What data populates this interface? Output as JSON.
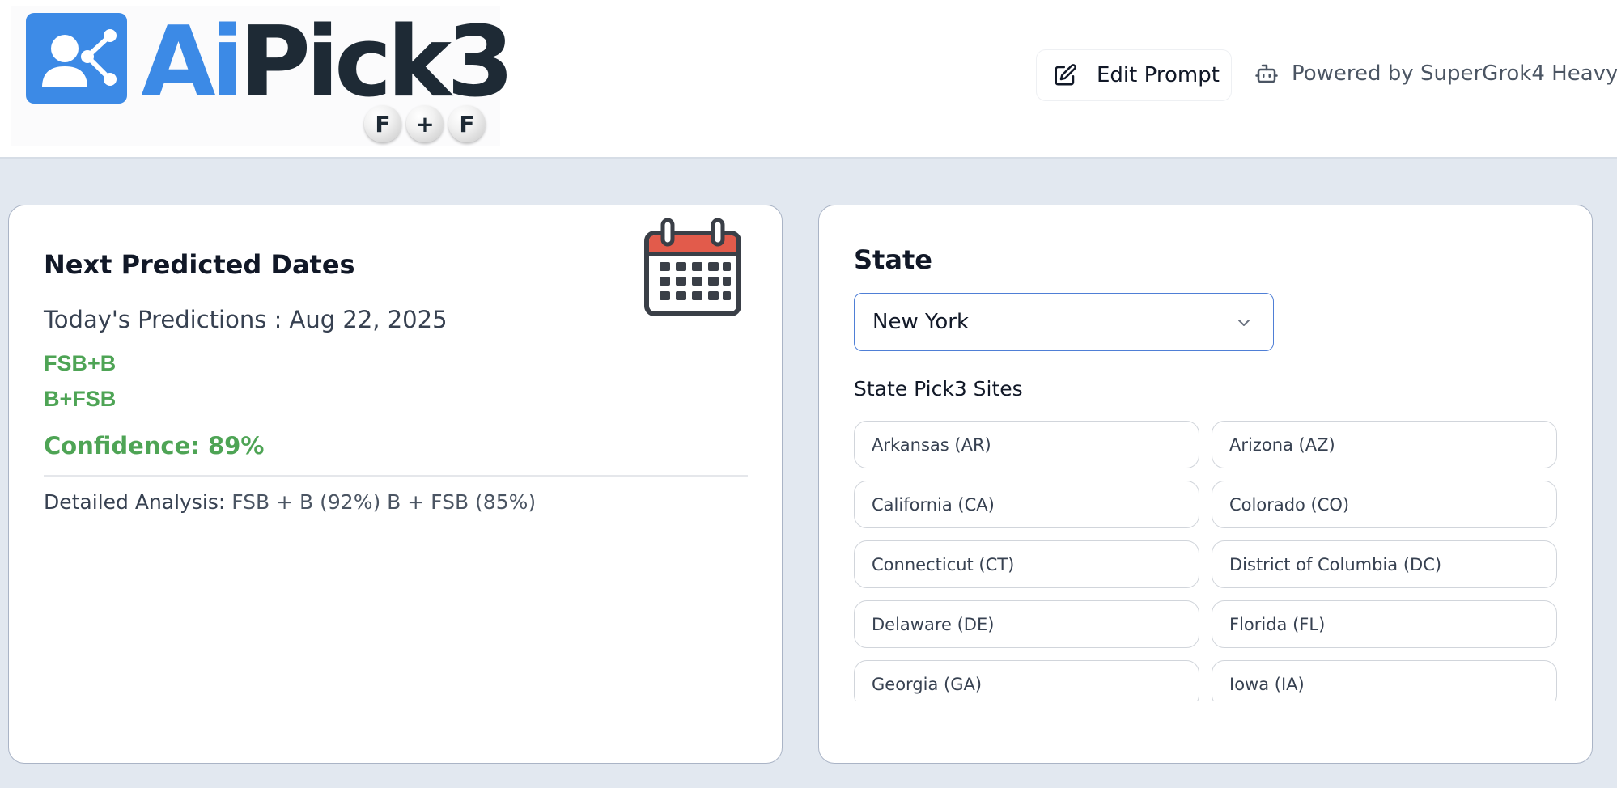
{
  "header": {
    "logo": {
      "text_ai": "Ai",
      "text_pick": "Pick3",
      "balls": [
        "F",
        "+",
        "F"
      ]
    },
    "edit_prompt_label": "Edit Prompt",
    "powered_by_label": "Powered by SuperGrok4 Heavy",
    "icons": {
      "edit": "edit-square-icon",
      "bot": "bot-icon"
    }
  },
  "predictions": {
    "title": "Next Predicted Dates",
    "today": "Today's Predictions : Aug 22, 2025",
    "picks": [
      "FSB+B",
      "B+FSB"
    ],
    "confidence": "Confidence: 89%",
    "analysis_label": "Detailed Analysis:",
    "analysis_value": "FSB + B (92%) B + FSB (85%)",
    "icon": "calendar-icon"
  },
  "state_panel": {
    "title": "State",
    "selected": "New York",
    "sites_title": "State Pick3 Sites",
    "sites": [
      "Arkansas (AR)",
      "Arizona (AZ)",
      "California (CA)",
      "Colorado (CO)",
      "Connecticut (CT)",
      "District of Columbia (DC)",
      "Delaware (DE)",
      "Florida (FL)",
      "Georgia (GA)",
      "Iowa (IA)"
    ]
  },
  "colors": {
    "brand_blue": "#3c8ae6",
    "brand_dark": "#1e2a35",
    "success_green": "#4ea455",
    "background": "#e2e8f0",
    "select_border": "#4f7fd6"
  }
}
